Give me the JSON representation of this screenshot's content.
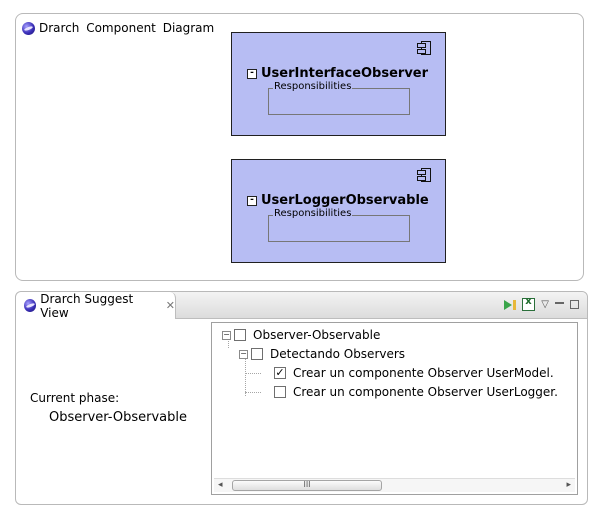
{
  "diagram": {
    "title": "Drarch Component Diagram",
    "components": [
      {
        "name": "UserInterfaceObserver",
        "responsibilities_label": "Responsibilities"
      },
      {
        "name": "UserLoggerObservable",
        "responsibilities_label": "Responsibilities"
      }
    ]
  },
  "suggest_view": {
    "tab_title": "Drarch Suggest View",
    "current_phase_label": "Current phase:",
    "current_phase_value": "Observer-Observable",
    "tree": {
      "root": "Observer-Observable",
      "child": "Detectando Observers",
      "items": [
        {
          "label": "Crear un componente Observer UserModel.",
          "checked": true
        },
        {
          "label": "Crear un componente Observer UserLogger.",
          "checked": false
        }
      ]
    },
    "scrollbar_thumb_grip": "III"
  },
  "colors": {
    "component_fill": "#b7bdf3",
    "panel_border": "#b9b9b9"
  }
}
